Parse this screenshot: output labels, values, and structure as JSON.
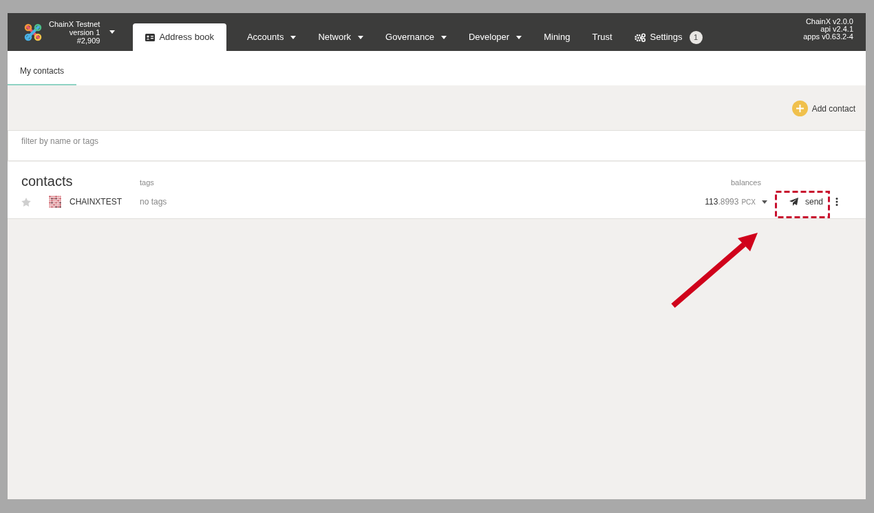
{
  "chain": {
    "name": "ChainX Testnet",
    "version": "version 1",
    "block": "#2,909"
  },
  "menu": [
    {
      "label": "Address book",
      "kind": "addressbook",
      "selected": true,
      "dropdown": false
    },
    {
      "label": "Accounts",
      "kind": "plain",
      "selected": false,
      "dropdown": true
    },
    {
      "label": "Network",
      "kind": "plain",
      "selected": false,
      "dropdown": true
    },
    {
      "label": "Governance",
      "kind": "plain",
      "selected": false,
      "dropdown": true
    },
    {
      "label": "Developer",
      "kind": "plain",
      "selected": false,
      "dropdown": true
    },
    {
      "label": "Mining",
      "kind": "plain",
      "selected": false,
      "dropdown": false
    },
    {
      "label": "Trust",
      "kind": "plain",
      "selected": false,
      "dropdown": false
    },
    {
      "label": "Settings",
      "kind": "settings",
      "selected": false,
      "dropdown": false,
      "badge": "1"
    }
  ],
  "versions": [
    "ChainX v2.0.0",
    "api v2.4.1",
    "apps v0.63.2-4"
  ],
  "tabs": [
    {
      "label": "My contacts",
      "selected": true
    }
  ],
  "add_button": "Add contact",
  "filter": {
    "placeholder": "filter by name or tags"
  },
  "table": {
    "title": "contacts",
    "columns": [
      "tags",
      "balances"
    ],
    "rows": [
      {
        "favorite": false,
        "name": "CHAINXTEST",
        "tags": "no tags",
        "balance_integer": "113",
        "balance_decimal": ".8993",
        "balance_unit": "PCX",
        "action": "send"
      }
    ]
  }
}
